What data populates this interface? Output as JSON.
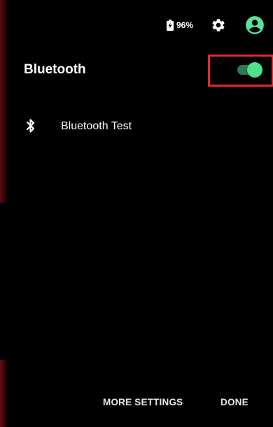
{
  "status_bar": {
    "battery_text": "96%",
    "battery_icon": "battery-charging-icon",
    "settings_icon": "gear-icon",
    "account_icon": "account-circle-icon"
  },
  "header": {
    "title": "Bluetooth",
    "toggle_state": "on"
  },
  "devices": [
    {
      "name": "Bluetooth Test",
      "icon": "bluetooth-icon"
    }
  ],
  "actions": {
    "more_settings": "MORE SETTINGS",
    "done": "DONE"
  },
  "colors": {
    "background": "#000000",
    "toggle_thumb": "#4fe08d",
    "toggle_track": "#2b7a55",
    "highlight": "#e8262e",
    "text": "#ffffff"
  }
}
